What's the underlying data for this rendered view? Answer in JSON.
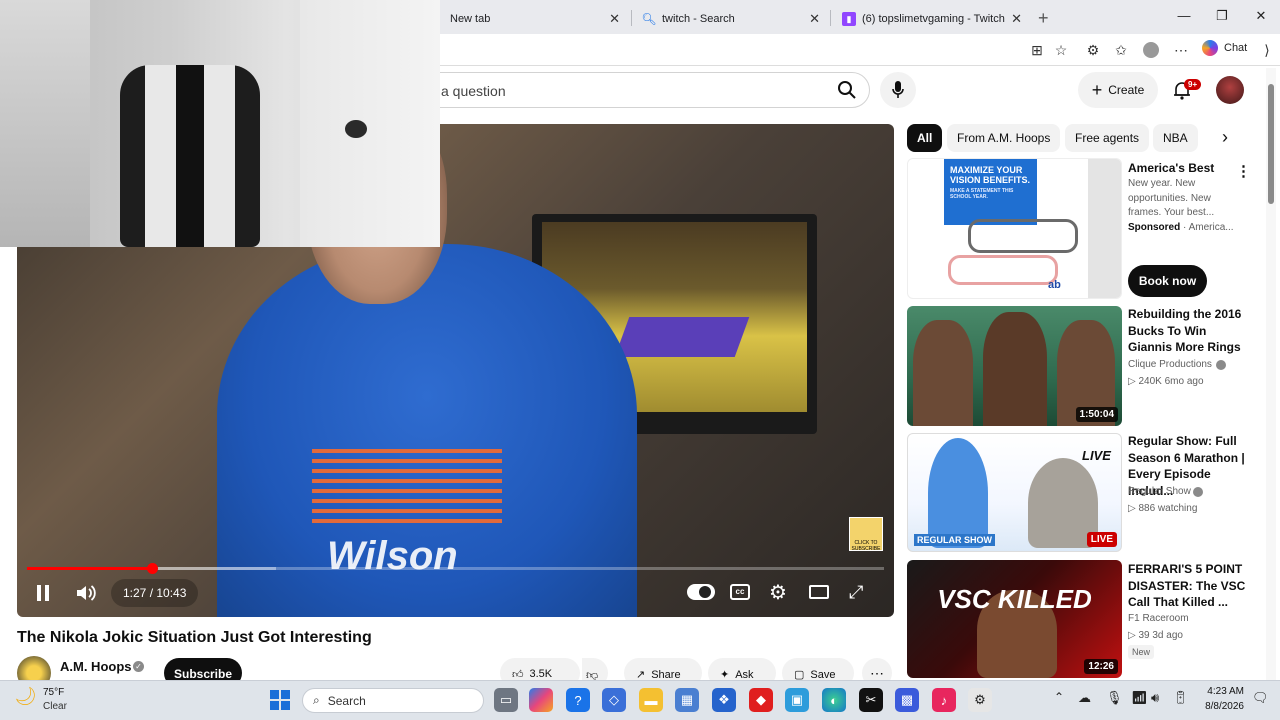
{
  "browser": {
    "tabs": [
      {
        "label": "New tab"
      },
      {
        "label": "twitch - Search"
      },
      {
        "label": "(6) topslimetvgaming - Twitch"
      }
    ],
    "chat_label": "Chat"
  },
  "youtube": {
    "search_placeholder": "a question",
    "create_label": "Create",
    "notif_count": "9+",
    "video": {
      "time": "1:27 / 10:43",
      "progress": 0.146,
      "title": "The Nikola Jokic Situation Just Got Interesting",
      "channel": "A.M. Hoops",
      "subscribe": "Subscribe",
      "likes": "3.5K",
      "share": "Share",
      "ask": "Ask",
      "save": "Save",
      "shirt_text": "Wilson",
      "corner_badge": "CLICK TO SUBSCRIBE"
    },
    "chips": [
      "All",
      "From A.M. Hoops",
      "Free agents",
      "NBA"
    ],
    "ad": {
      "title": "America's Best",
      "desc": "New year. New opportunities. New frames. Your best...",
      "sponsored": "Sponsored",
      "advertiser": "America...",
      "cta": "Book now",
      "thumb_headline": "MAXIMIZE YOUR VISION BENEFITS.",
      "thumb_sub": "MAKE A STATEMENT THIS SCHOOL YEAR.",
      "thumb_logo": "ab"
    },
    "recommendations": [
      {
        "title": "Rebuilding the 2016 Bucks To Win Giannis More Rings",
        "channel": "Clique Productions",
        "meta": "240K  6mo ago",
        "duration": "1:50:04"
      },
      {
        "title": "Regular Show: Full Season 6 Marathon | Every Episode Includ...",
        "channel": "Regular Show",
        "meta": "886 watching",
        "badge": "LIVE",
        "thumb_text": "LIVE",
        "thumb_logo": "REGULAR SHOW"
      },
      {
        "title": "FERRARI'S 5 POINT DISASTER: The VSC Call That Killed ...",
        "channel": "F1 Raceroom",
        "meta": "39  3d ago",
        "new_badge": "New",
        "duration": "12:26",
        "thumb_text": "VSC KILLED"
      }
    ]
  },
  "taskbar": {
    "weather_temp": "75°F",
    "weather_desc": "Clear",
    "search_label": "Search",
    "time": "4:23 AM",
    "date": "8/8/2026"
  },
  "colors": {
    "yt_red": "#ff0000",
    "accent_blue": "#065fd4"
  }
}
